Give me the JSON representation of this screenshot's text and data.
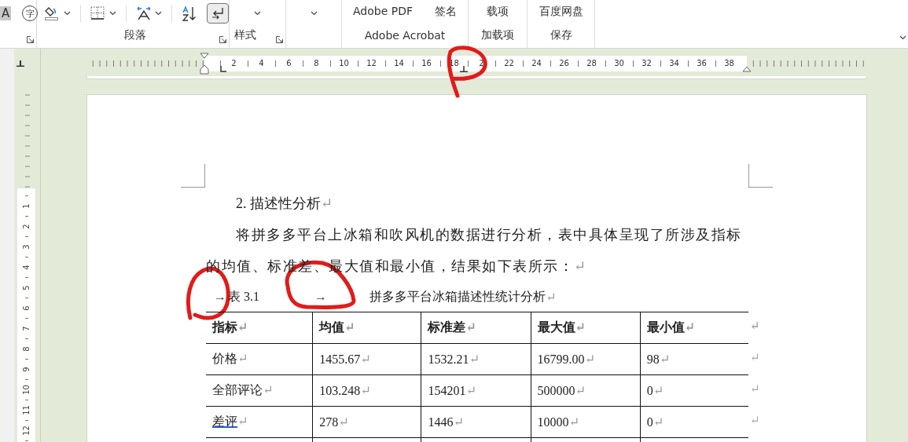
{
  "ribbon": {
    "font_group": {
      "buttons": [
        {
          "kind": "shaded",
          "label": "A"
        },
        {
          "kind": "circled",
          "label": "字"
        }
      ]
    },
    "paragraph_group": {
      "label": "段落",
      "tools": [
        {
          "kind": "shading",
          "dropdown": true,
          "selected": false
        },
        {
          "kind": "borders",
          "dropdown": true,
          "selected": false
        },
        {
          "kind": "spacing",
          "dropdown": true,
          "selected": false
        },
        {
          "kind": "sort",
          "dropdown": false,
          "selected": false
        },
        {
          "kind": "marks",
          "dropdown": false,
          "selected": true
        }
      ]
    },
    "styles_group": {
      "label": "样式"
    },
    "acrobat_group": {
      "label": "Adobe Acrobat",
      "buttons": [
        "Adobe PDF",
        "签名"
      ]
    },
    "addins_group": {
      "label": "加载项",
      "buttons": [
        "载项"
      ]
    },
    "save_group": {
      "label": "保存",
      "buttons": [
        "百度网盘"
      ]
    }
  },
  "ruler": {
    "numbers": [
      "2",
      "4",
      "6",
      "8",
      "10",
      "12",
      "14",
      "16",
      "18",
      "2",
      "22",
      "24",
      "26",
      "28",
      "30",
      "32",
      "34",
      "36",
      "38"
    ]
  },
  "vertical_ruler": {
    "numbers": [
      "1",
      "2",
      "3",
      "4",
      "5",
      "6",
      "7",
      "8",
      "9",
      "10",
      "11",
      "12"
    ]
  },
  "document": {
    "heading": {
      "text": "2. 描述性分析",
      "mark": "↵"
    },
    "paragraph": {
      "text": "将拼多多平台上冰箱和吹风机的数据进行分析，表中具体呈现了所涉及指标的均值、标准差、最大值和最小值，结果如下表所示：",
      "mark": "↵"
    },
    "caption": {
      "tab": "→",
      "label": "表 3.1",
      "tab_2": "→",
      "title": "拼多多平台冰箱描述性统计分析",
      "mark": "↵"
    },
    "table": {
      "columns": [
        {
          "text": "指标",
          "mark": "↵"
        },
        {
          "text": "均值",
          "mark": "↵"
        },
        {
          "text": "标准差",
          "mark": "↵"
        },
        {
          "text": "最大值",
          "mark": "↵"
        },
        {
          "text": "最小值",
          "mark": "↵"
        }
      ],
      "header_end_mark": "↵",
      "rows": [
        {
          "end_mark": "↵",
          "cells": [
            {
              "text": "价格",
              "mark": "↵",
              "flagged": false
            },
            {
              "text": "1455.67",
              "mark": "↵",
              "flagged": false
            },
            {
              "text": "1532.21",
              "mark": "↵",
              "flagged": false
            },
            {
              "text": "16799.00",
              "mark": "↵",
              "flagged": false
            },
            {
              "text": "98",
              "mark": "↵",
              "flagged": false
            }
          ]
        },
        {
          "end_mark": "↵",
          "cells": [
            {
              "text": "全部评论",
              "mark": "↵",
              "flagged": false
            },
            {
              "text": "103.248",
              "mark": "↵",
              "flagged": false
            },
            {
              "text": "154201",
              "mark": "↵",
              "flagged": false
            },
            {
              "text": "500000",
              "mark": "↵",
              "flagged": false
            },
            {
              "text": "0",
              "mark": "↵",
              "flagged": false
            }
          ]
        },
        {
          "end_mark": "↵",
          "cells": [
            {
              "text": "差评",
              "mark": "↵",
              "flagged": true
            },
            {
              "text": "278",
              "mark": "↵",
              "flagged": false
            },
            {
              "text": "1446",
              "mark": "↵",
              "flagged": false
            },
            {
              "text": "10000",
              "mark": "↵",
              "flagged": false
            },
            {
              "text": "0",
              "mark": "↵",
              "flagged": false
            }
          ]
        }
      ]
    }
  }
}
